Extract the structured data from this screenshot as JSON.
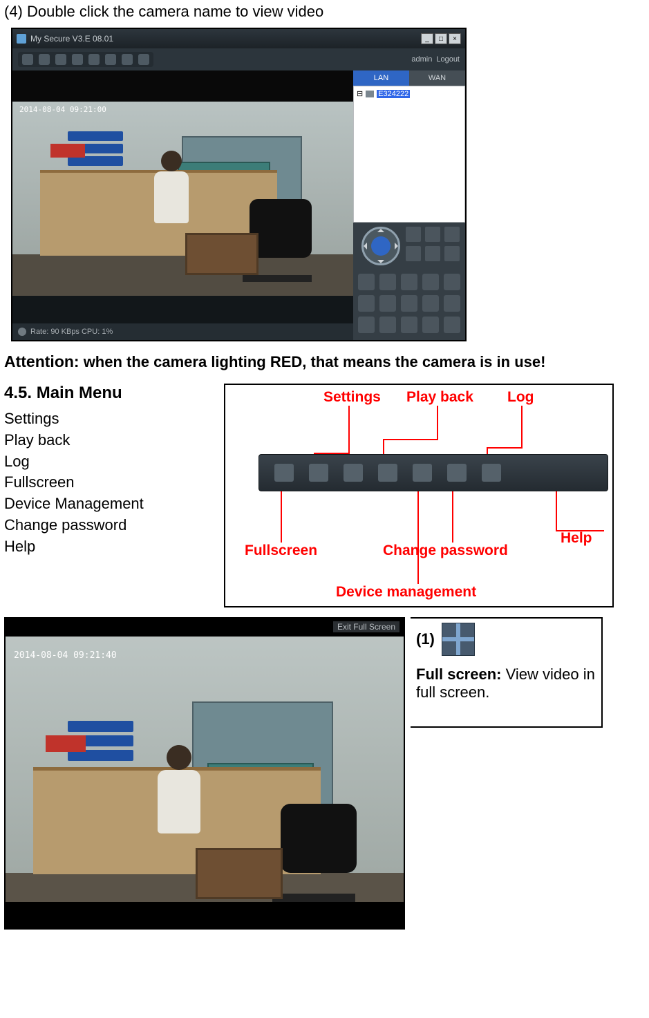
{
  "step_line": "(4) Double click the camera name to view video",
  "app": {
    "title": "My Secure  V3.E 08.01",
    "window_controls": {
      "min": "_",
      "max": "□",
      "close": "×"
    },
    "account": {
      "user": "admin",
      "logout": "Logout"
    },
    "camera_id": "E324222",
    "video_timestamp": "2014-08-04 09:21:00",
    "status": "Rate: 90 KBps  CPU:  1%",
    "net_tabs": {
      "lan": "LAN",
      "wan": "WAN"
    },
    "device_name": "E324222"
  },
  "attention": {
    "label": "Attention:",
    "text": " when the camera lighting RED, that means the camera is in use!"
  },
  "section_title": "4.5. Main Menu",
  "menu_items": [
    "Settings",
    "Play back",
    "Log",
    "Fullscreen",
    "Device Management",
    "Change password",
    "Help"
  ],
  "callouts": {
    "settings": "Settings",
    "playback": "Play back",
    "log": "Log",
    "fullscreen": "Fullscreen",
    "change_pw": "Change password",
    "help": "Help",
    "device_mgmt": "Device management"
  },
  "fig3": {
    "exit_label": "Exit Full Screen",
    "timestamp": "2014-08-04 09:21:40"
  },
  "fullscreen_desc": {
    "idx": "(1)",
    "label": "Full screen:",
    "text": " View video in full screen."
  }
}
